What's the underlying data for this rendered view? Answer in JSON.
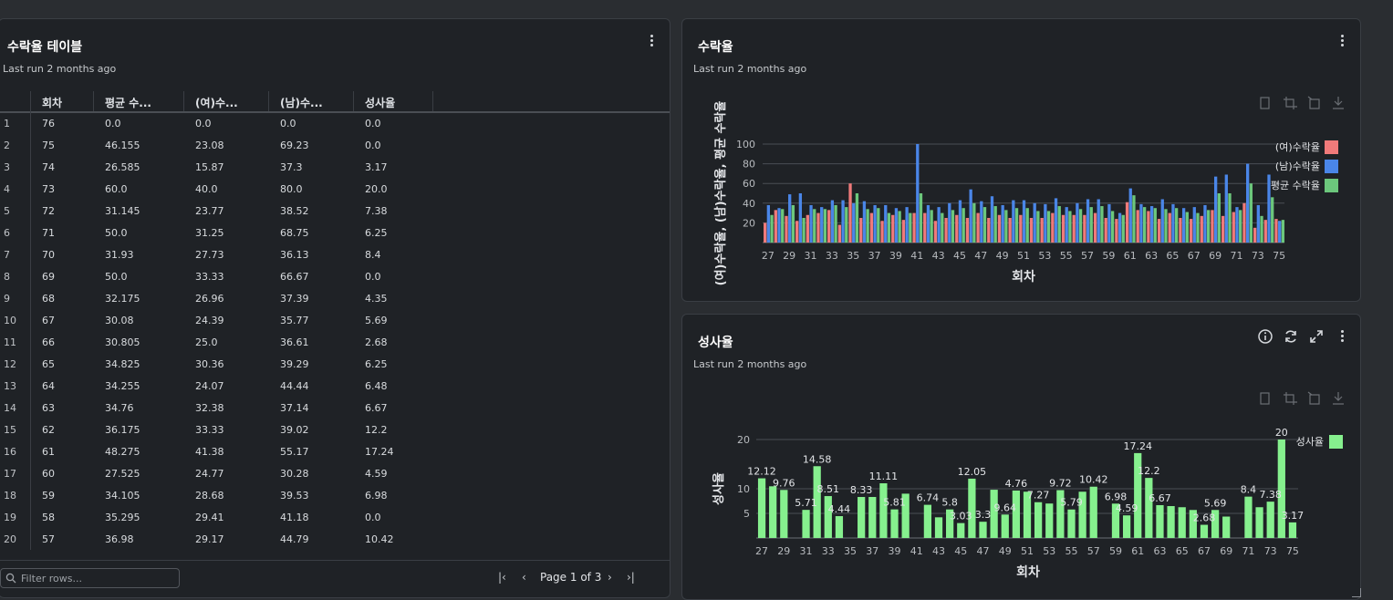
{
  "table_card": {
    "title": "수락율 테이블",
    "subtitle": "Last run 2 months ago",
    "columns": [
      "회차",
      "평균 수...",
      "(여)수...",
      "(남)수...",
      "성사율"
    ],
    "rows": [
      [
        "1",
        "76",
        "0.0",
        "0.0",
        "0.0",
        "0.0"
      ],
      [
        "2",
        "75",
        "46.155",
        "23.08",
        "69.23",
        "0.0"
      ],
      [
        "3",
        "74",
        "26.585",
        "15.87",
        "37.3",
        "3.17"
      ],
      [
        "4",
        "73",
        "60.0",
        "40.0",
        "80.0",
        "20.0"
      ],
      [
        "5",
        "72",
        "31.145",
        "23.77",
        "38.52",
        "7.38"
      ],
      [
        "6",
        "71",
        "50.0",
        "31.25",
        "68.75",
        "6.25"
      ],
      [
        "7",
        "70",
        "31.93",
        "27.73",
        "36.13",
        "8.4"
      ],
      [
        "8",
        "69",
        "50.0",
        "33.33",
        "66.67",
        "0.0"
      ],
      [
        "9",
        "68",
        "32.175",
        "26.96",
        "37.39",
        "4.35"
      ],
      [
        "10",
        "67",
        "30.08",
        "24.39",
        "35.77",
        "5.69"
      ],
      [
        "11",
        "66",
        "30.805",
        "25.0",
        "36.61",
        "2.68"
      ],
      [
        "12",
        "65",
        "34.825",
        "30.36",
        "39.29",
        "6.25"
      ],
      [
        "13",
        "64",
        "34.255",
        "24.07",
        "44.44",
        "6.48"
      ],
      [
        "14",
        "63",
        "34.76",
        "32.38",
        "37.14",
        "6.67"
      ],
      [
        "15",
        "62",
        "36.175",
        "33.33",
        "39.02",
        "12.2"
      ],
      [
        "16",
        "61",
        "48.275",
        "41.38",
        "55.17",
        "17.24"
      ],
      [
        "17",
        "60",
        "27.525",
        "24.77",
        "30.28",
        "4.59"
      ],
      [
        "18",
        "59",
        "34.105",
        "28.68",
        "39.53",
        "6.98"
      ],
      [
        "19",
        "58",
        "35.295",
        "29.41",
        "41.18",
        "0.0"
      ],
      [
        "20",
        "57",
        "36.98",
        "29.17",
        "44.79",
        "10.42"
      ]
    ],
    "filter_placeholder": "Filter rows...",
    "page_label": "Page 1 of 3"
  },
  "accept_card": {
    "title": "수락율",
    "subtitle": "Last run 2 months ago"
  },
  "success_card": {
    "title": "성사율",
    "subtitle": "Last run 2 months ago"
  },
  "colors": {
    "female": "#f07a7a",
    "male": "#4a86e8",
    "average": "#6cc77c",
    "success": "#86f08e",
    "background": "#1f2226"
  },
  "chart_data": [
    {
      "type": "bar",
      "title": "수락율",
      "xlabel": "회차",
      "ylabel": "(여)수락율, (남)수락율, 평균 수락율",
      "ylim": [
        0,
        110
      ],
      "yticks": [
        20,
        40,
        60,
        80,
        100
      ],
      "x": [
        27,
        28,
        29,
        30,
        31,
        32,
        33,
        34,
        35,
        36,
        37,
        38,
        39,
        40,
        41,
        42,
        43,
        44,
        45,
        46,
        47,
        48,
        49,
        50,
        51,
        52,
        53,
        54,
        55,
        56,
        57,
        58,
        59,
        60,
        61,
        62,
        63,
        64,
        65,
        66,
        67,
        68,
        69,
        70,
        71,
        72,
        73,
        74,
        75
      ],
      "xtick_labels": [
        "27",
        "29",
        "31",
        "33",
        "35",
        "37",
        "39",
        "41",
        "43",
        "45",
        "47",
        "49",
        "51",
        "53",
        "55",
        "57",
        "59",
        "61",
        "63",
        "65",
        "67",
        "69",
        "71",
        "73",
        "75"
      ],
      "legend_position": "right",
      "series": [
        {
          "name": "(여)수락율",
          "values": [
            20,
            33,
            27,
            22,
            28,
            30,
            33,
            18,
            60,
            25,
            30,
            22,
            28,
            23,
            30,
            30,
            22,
            25,
            28,
            25,
            30,
            25,
            28,
            25,
            28,
            25,
            25,
            30,
            28,
            28,
            28,
            30,
            25,
            24,
            41,
            33,
            32,
            24,
            30,
            25,
            24,
            27,
            33,
            27,
            31,
            40,
            15,
            23,
            24
          ]
        },
        {
          "name": "(남)수락율",
          "values": [
            38,
            35,
            49,
            50,
            38,
            36,
            43,
            43,
            40,
            42,
            38,
            38,
            35,
            36,
            100,
            38,
            36,
            40,
            43,
            54,
            42,
            47,
            38,
            43,
            43,
            40,
            39,
            45,
            36,
            40,
            44,
            44,
            39,
            30,
            55,
            39,
            37,
            44,
            39,
            35,
            36,
            38,
            67,
            69,
            36,
            80,
            38,
            69,
            22
          ]
        },
        {
          "name": "평균 수락율",
          "values": [
            28,
            34,
            38,
            25,
            34,
            34,
            38,
            36,
            50,
            34,
            35,
            30,
            32,
            30,
            50,
            33,
            30,
            33,
            35,
            40,
            36,
            37,
            33,
            35,
            35,
            32,
            32,
            37,
            32,
            34,
            36,
            37,
            32,
            28,
            48,
            36,
            35,
            34,
            35,
            31,
            30,
            33,
            50,
            50,
            33,
            60,
            27,
            46,
            23
          ]
        }
      ]
    },
    {
      "type": "bar",
      "title": "성사율",
      "xlabel": "회차",
      "ylabel": "성사율",
      "ylim": [
        0,
        22
      ],
      "yticks": [
        5,
        10,
        20
      ],
      "x": [
        27,
        28,
        29,
        30,
        31,
        32,
        33,
        34,
        35,
        36,
        37,
        38,
        39,
        40,
        41,
        42,
        43,
        44,
        45,
        46,
        47,
        48,
        49,
        50,
        51,
        52,
        53,
        54,
        55,
        56,
        57,
        58,
        59,
        60,
        61,
        62,
        63,
        64,
        65,
        66,
        67,
        68,
        69,
        70,
        71,
        72,
        73,
        74,
        75
      ],
      "xtick_labels": [
        "27",
        "29",
        "31",
        "33",
        "35",
        "37",
        "39",
        "41",
        "43",
        "45",
        "47",
        "49",
        "51",
        "53",
        "55",
        "57",
        "59",
        "61",
        "63",
        "65",
        "67",
        "69",
        "71",
        "73",
        "75"
      ],
      "legend_position": "top-right",
      "series": [
        {
          "name": "성사율",
          "values": [
            12.12,
            10.5,
            9.76,
            0,
            5.71,
            14.58,
            8.51,
            4.44,
            0,
            8.33,
            8.33,
            11.11,
            5.81,
            9.0,
            0,
            6.74,
            4.2,
            5.8,
            3.03,
            12.05,
            3.3,
            9.8,
            4.76,
            9.64,
            9.4,
            7.27,
            7.0,
            9.72,
            5.79,
            9.4,
            10.42,
            0,
            6.98,
            4.59,
            17.24,
            12.2,
            6.67,
            6.48,
            6.25,
            5.69,
            2.68,
            5.69,
            4.35,
            0,
            8.4,
            6.25,
            7.38,
            20.0,
            3.17
          ]
        }
      ],
      "data_labels": [
        "12.12",
        "9.76",
        "5.71",
        "14.58",
        "8.51",
        "4.44",
        "8.33",
        "11.11",
        "5.81",
        "6.74",
        "5.8",
        "3.03",
        "12.05",
        "3.3",
        "9.64",
        "4.76",
        "7.27",
        "9.72",
        "5.79",
        "10.42",
        "6.98",
        "4.59",
        "17.24",
        "12.2",
        "6.67",
        "2.68",
        "5.69",
        "8.4",
        "7.38",
        "20",
        "3.17"
      ]
    }
  ]
}
